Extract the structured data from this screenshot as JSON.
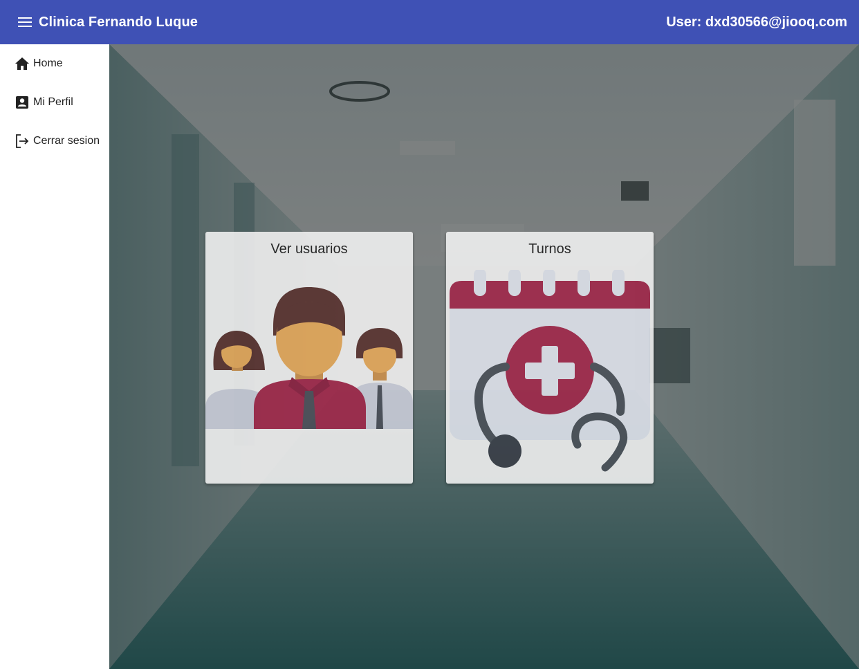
{
  "header": {
    "title": "Clinica Fernando Luque",
    "user_label": "User: dxd30566@jiooq.com",
    "color": "#3f51b5"
  },
  "sidebar": {
    "items": [
      {
        "label": "Home",
        "icon": "home-icon"
      },
      {
        "label": "Mi Perfil",
        "icon": "account-box-icon"
      },
      {
        "label": "Cerrar sesion",
        "icon": "logout-icon"
      }
    ]
  },
  "cards": [
    {
      "title": "Ver usuarios",
      "icon": "users-group-icon"
    },
    {
      "title": "Turnos",
      "icon": "calendar-medical-icon"
    }
  ],
  "colors": {
    "accent_red": "#a0284a",
    "skin": "#e4a85a",
    "hair": "#5a3330",
    "calendar_bg": "#dde1ea"
  }
}
